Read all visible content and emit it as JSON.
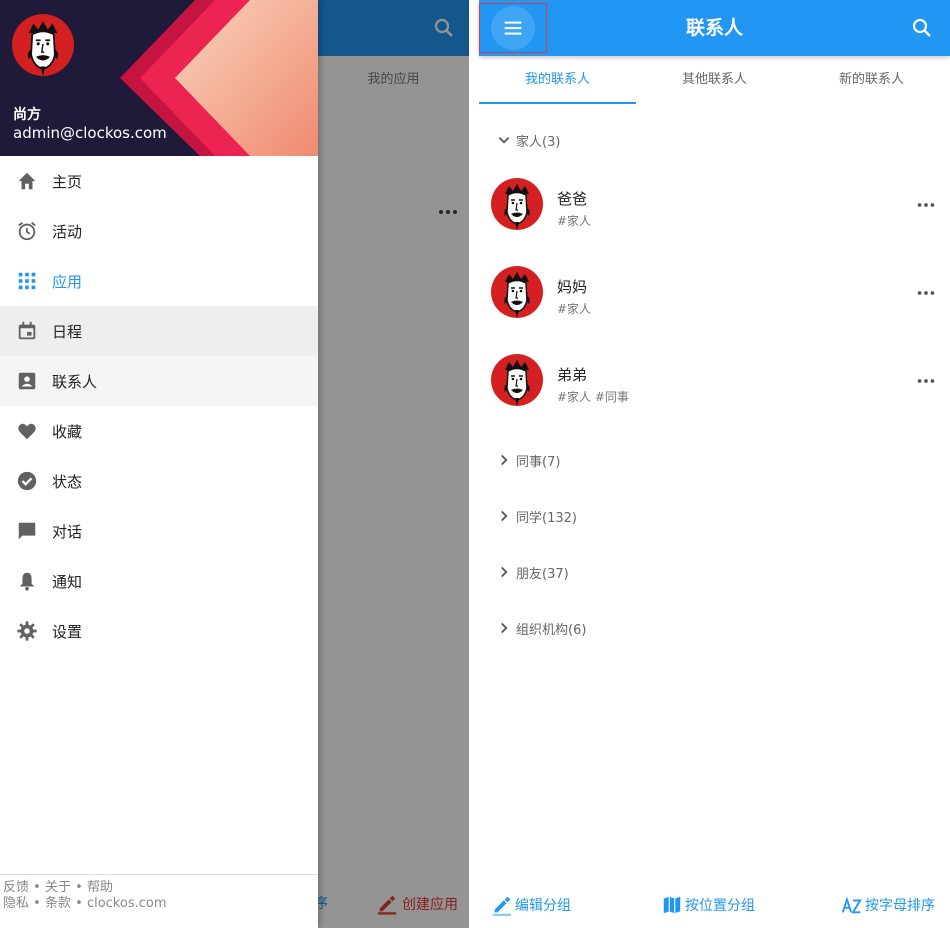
{
  "background_app": {
    "tab_label": "我的应用",
    "bottom_left_label": "排序",
    "bottom_right_label": "创建应用"
  },
  "drawer": {
    "user": {
      "name": "尚方",
      "email": "admin@clockos.com"
    },
    "items": [
      {
        "label": "主页",
        "icon": "home-icon"
      },
      {
        "label": "活动",
        "icon": "alarm-icon"
      },
      {
        "label": "应用",
        "icon": "apps-grid-icon"
      },
      {
        "label": "日程",
        "icon": "calendar-icon"
      },
      {
        "label": "联系人",
        "icon": "contact-card-icon"
      },
      {
        "label": "收藏",
        "icon": "heart-icon"
      },
      {
        "label": "状态",
        "icon": "check-circle-icon"
      },
      {
        "label": "对话",
        "icon": "chat-icon"
      },
      {
        "label": "通知",
        "icon": "bell-icon"
      },
      {
        "label": "设置",
        "icon": "gear-icon"
      }
    ],
    "footer": {
      "line1": [
        "反馈",
        "关于",
        "帮助"
      ],
      "line2": [
        "隐私",
        "条款",
        "clockos.com"
      ],
      "separator": "•"
    }
  },
  "contacts_app": {
    "title": "联系人",
    "tabs": [
      "我的联系人",
      "其他联系人",
      "新的联系人"
    ],
    "expanded_group": "家人(3)",
    "contacts": [
      {
        "name": "爸爸",
        "tags": "#家人"
      },
      {
        "name": "妈妈",
        "tags": "#家人"
      },
      {
        "name": "弟弟",
        "tags": "#家人 #同事"
      }
    ],
    "collapsed_groups": [
      "同事(7)",
      "同学(132)",
      "朋友(37)",
      "组织机构(6)"
    ],
    "bottom_actions": [
      "编辑分组",
      "按位置分组",
      "按字母排序"
    ]
  },
  "colors": {
    "primary": "#2196f3",
    "accent_red": "#e53935",
    "drawer_header": "#1f1a3a"
  }
}
